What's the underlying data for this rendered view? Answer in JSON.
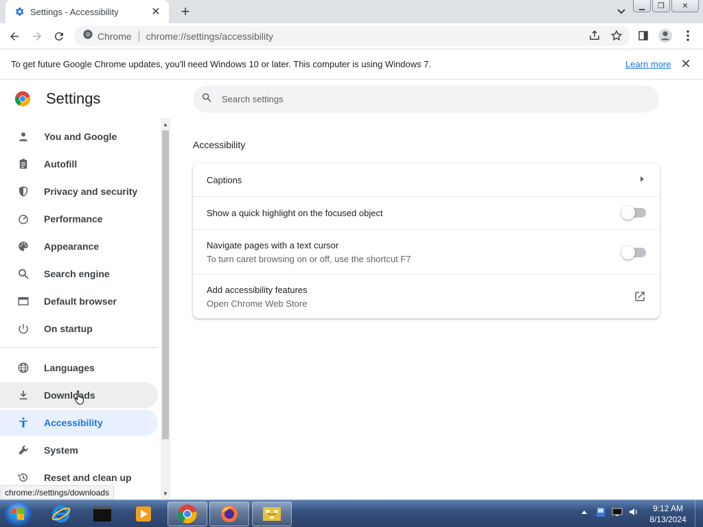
{
  "browser": {
    "tab_title": "Settings - Accessibility",
    "omnibox_site": "Chrome",
    "omnibox_url": "chrome://settings/accessibility",
    "icons": [
      "settings-favicon",
      "close-icon",
      "plus-icon",
      "tab-search-icon",
      "back-arrow-icon",
      "forward-arrow-icon",
      "reload-icon",
      "share-icon",
      "star-icon",
      "side-panel-icon",
      "profile-icon",
      "kebab-menu-icon"
    ]
  },
  "infobar": {
    "message": "To get future Google Chrome updates, you'll need Windows 10 or later. This computer is using Windows 7.",
    "link": "Learn more"
  },
  "settings": {
    "title": "Settings",
    "search_placeholder": "Search settings"
  },
  "sidebar": {
    "items": [
      {
        "label": "You and Google",
        "icon": "person-icon"
      },
      {
        "label": "Autofill",
        "icon": "clipboard-icon"
      },
      {
        "label": "Privacy and security",
        "icon": "shield-icon"
      },
      {
        "label": "Performance",
        "icon": "gauge-icon"
      },
      {
        "label": "Appearance",
        "icon": "palette-icon"
      },
      {
        "label": "Search engine",
        "icon": "search-icon"
      },
      {
        "label": "Default browser",
        "icon": "browser-window-icon"
      },
      {
        "label": "On startup",
        "icon": "power-icon"
      },
      {
        "label": "Languages",
        "icon": "globe-icon"
      },
      {
        "label": "Downloads",
        "icon": "download-icon",
        "state": "hover"
      },
      {
        "label": "Accessibility",
        "icon": "accessibility-icon",
        "state": "selected"
      },
      {
        "label": "System",
        "icon": "wrench-icon"
      },
      {
        "label": "Reset and clean up",
        "icon": "history-icon"
      }
    ]
  },
  "status_url": "chrome://settings/downloads",
  "accessibility": {
    "section_title": "Accessibility",
    "rows": [
      {
        "label": "Captions",
        "action": "arrow-right-icon"
      },
      {
        "label": "Show a quick highlight on the focused object",
        "toggle": false
      },
      {
        "label": "Navigate pages with a text cursor",
        "sublabel": "To turn caret browsing on or off, use the shortcut F7",
        "toggle": false
      },
      {
        "label": "Add accessibility features",
        "sublabel": "Open Chrome Web Store",
        "action": "open-in-new-icon"
      }
    ]
  },
  "taskbar": {
    "time": "9:12 AM",
    "date": "8/13/2024",
    "apps": [
      "internet-explorer-icon",
      "terminal-icon",
      "media-player-icon",
      "chrome-icon",
      "firefox-icon",
      "network-app-icon"
    ]
  },
  "colors": {
    "accent": "#1a73e8",
    "selected_bg": "#e8f0fe",
    "hover_bg": "#eeeeee",
    "taskbar": "#34507c"
  }
}
